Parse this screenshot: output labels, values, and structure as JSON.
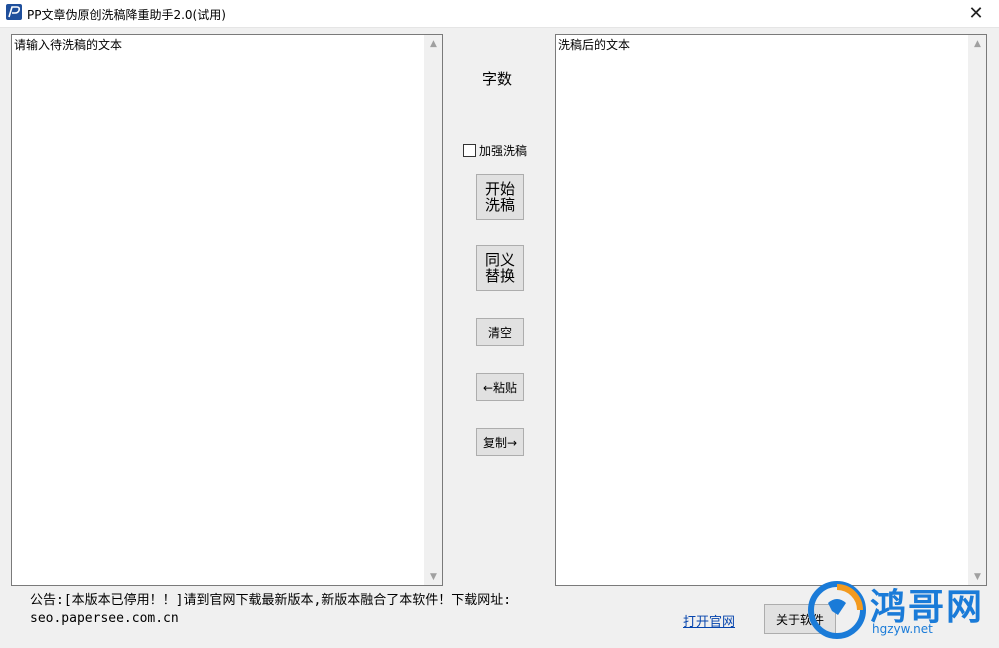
{
  "window": {
    "title": "PP文章伪原创洗稿降重助手2.0(试用)",
    "close_glyph": "✕"
  },
  "input_box": {
    "text": "请输入待洗稿的文本"
  },
  "output_box": {
    "text": "洗稿后的文本"
  },
  "center": {
    "word_count_label": "字数",
    "enhance_checkbox_label": "加强洗稿",
    "enhance_checked": false,
    "start_button": "开始\n洗稿",
    "synonym_button": "同义\n替换",
    "clear_button": "清空",
    "paste_button": "←粘贴",
    "copy_button": "复制→"
  },
  "footer": {
    "notice_line1": "公告:[本版本已停用！！]请到官网下载最新版本,新版本融合了本软件！下载网址:",
    "notice_line2": "seo.papersee.com.cn",
    "open_site_link": "打开官网",
    "about_button": "关于软件"
  },
  "watermark": {
    "big_text": "鸿哥网",
    "small_text": "hgzyw.net",
    "color": "#1a7bd8"
  },
  "icons": {
    "app": "pp-logo-icon",
    "scroll_up": "▲",
    "scroll_down": "▼"
  }
}
